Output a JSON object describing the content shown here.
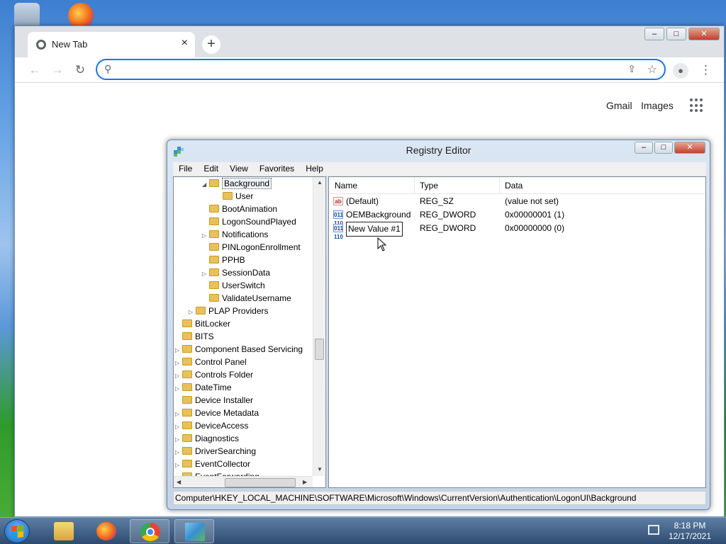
{
  "chrome": {
    "tab_title": "New Tab",
    "tab_close": "×",
    "new_tab": "+",
    "omnibox_value": "",
    "gmail": "Gmail",
    "images": "Images",
    "window_controls": {
      "minimize": "–",
      "maximize": "□",
      "close": "✕"
    }
  },
  "regedit": {
    "title": "Registry Editor",
    "window_controls": {
      "minimize": "–",
      "maximize": "□",
      "close": "✕"
    },
    "menu": [
      "File",
      "Edit",
      "View",
      "Favorites",
      "Help"
    ],
    "tree": [
      {
        "label": "Background",
        "indent": 2,
        "expander": "◢",
        "selected": true
      },
      {
        "label": "User",
        "indent": 3,
        "expander": ""
      },
      {
        "label": "BootAnimation",
        "indent": 2,
        "expander": ""
      },
      {
        "label": "LogonSoundPlayed",
        "indent": 2,
        "expander": ""
      },
      {
        "label": "Notifications",
        "indent": 2,
        "expander": "▷"
      },
      {
        "label": "PINLogonEnrollment",
        "indent": 2,
        "expander": ""
      },
      {
        "label": "PPHB",
        "indent": 2,
        "expander": ""
      },
      {
        "label": "SessionData",
        "indent": 2,
        "expander": "▷"
      },
      {
        "label": "UserSwitch",
        "indent": 2,
        "expander": ""
      },
      {
        "label": "ValidateUsername",
        "indent": 2,
        "expander": ""
      },
      {
        "label": "PLAP Providers",
        "indent": 1,
        "expander": "▷"
      },
      {
        "label": "BitLocker",
        "indent": 0,
        "expander": ""
      },
      {
        "label": "BITS",
        "indent": 0,
        "expander": ""
      },
      {
        "label": "Component Based Servicing",
        "indent": 0,
        "expander": "▷"
      },
      {
        "label": "Control Panel",
        "indent": 0,
        "expander": "▷"
      },
      {
        "label": "Controls Folder",
        "indent": 0,
        "expander": "▷"
      },
      {
        "label": "DateTime",
        "indent": 0,
        "expander": "▷"
      },
      {
        "label": "Device Installer",
        "indent": 0,
        "expander": ""
      },
      {
        "label": "Device Metadata",
        "indent": 0,
        "expander": "▷"
      },
      {
        "label": "DeviceAccess",
        "indent": 0,
        "expander": "▷"
      },
      {
        "label": "Diagnostics",
        "indent": 0,
        "expander": "▷"
      },
      {
        "label": "DriverSearching",
        "indent": 0,
        "expander": "▷"
      },
      {
        "label": "EventCollector",
        "indent": 0,
        "expander": "▷"
      },
      {
        "label": "EventForwarding",
        "indent": 0,
        "expander": "▷"
      }
    ],
    "columns": {
      "name": "Name",
      "type": "Type",
      "data": "Data"
    },
    "values": [
      {
        "icon": "ab",
        "kind": "string",
        "name": "(Default)",
        "type": "REG_SZ",
        "data": "(value not set)"
      },
      {
        "icon": "011\n110",
        "kind": "binary",
        "name": "OEMBackground",
        "type": "REG_DWORD",
        "data": "0x00000001 (1)"
      },
      {
        "icon": "011\n110",
        "kind": "binary",
        "name": "New Value #1",
        "type": "REG_DWORD",
        "data": "0x00000000 (0)",
        "editing": true
      }
    ],
    "status_path": "Computer\\HKEY_LOCAL_MACHINE\\SOFTWARE\\Microsoft\\Windows\\CurrentVersion\\Authentication\\LogonUI\\Background"
  },
  "taskbar": {
    "items": [
      "file-explorer-icon",
      "firefox-icon",
      "chrome-icon",
      "registry-editor-icon"
    ],
    "time": "8:18 PM",
    "date": "12/17/2021"
  }
}
